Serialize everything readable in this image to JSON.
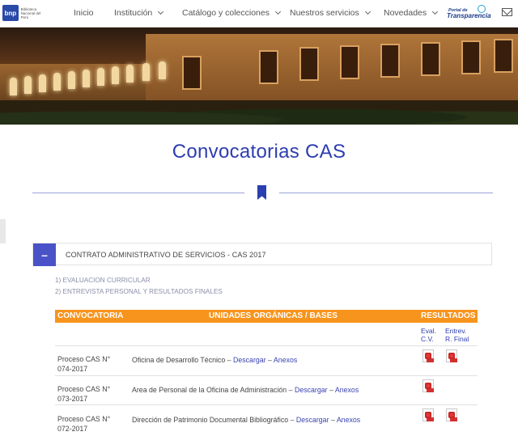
{
  "header": {
    "logo_mark": "bnp",
    "logo_text": "Biblioteca Nacional del Perú",
    "nav": [
      {
        "label": "Inicio",
        "dropdown": false
      },
      {
        "label": "Institución",
        "dropdown": true
      },
      {
        "label": "Catálogo y colecciones",
        "dropdown": true
      },
      {
        "label": "Nuestros servicios",
        "dropdown": true
      },
      {
        "label": "Novedades",
        "dropdown": true
      }
    ],
    "transparency_top": "Portal de",
    "transparency_main": "Transparencia",
    "mail_icon": "envelope-icon"
  },
  "page": {
    "title": "Convocatorias CAS"
  },
  "accordion": {
    "toggle_symbol": "–",
    "label": "CONTRATO ADMINISTRATIVO DE SERVICIOS - CAS 2017"
  },
  "links": [
    "1) EVALUACION CURRICULAR",
    "2) ENTREVISTA PERSONAL Y RESULTADOS FINALES"
  ],
  "table": {
    "headers": {
      "convocatoria": "CONVOCATORIA",
      "unidades": "UNIDADES ORGÁNICAS / BASES",
      "resultados": "RESULTADOS"
    },
    "subheaders": {
      "eval_line1": "Eval.",
      "eval_line2": "C.V.",
      "entrev_line1": "Entrev.",
      "entrev_line2": "R. Final"
    },
    "rows": [
      {
        "proceso_line1": "Proceso CAS N°",
        "proceso_line2": "074-2017",
        "unidad": "Oficina de Desarrollo Técnico – ",
        "descargar": "Descargar",
        "sep": " – ",
        "anexos": "Anexos",
        "eval_pdf": true,
        "entrev_pdf": true
      },
      {
        "proceso_line1": "Proceso CAS N°",
        "proceso_line2": "073-2017",
        "unidad": "Area de Personal de la Oficina de Administración – ",
        "descargar": "Descargar",
        "sep": " – ",
        "anexos": "Anexos",
        "eval_pdf": true,
        "entrev_pdf": false
      },
      {
        "proceso_line1": "Proceso CAS N°",
        "proceso_line2": "072-2017",
        "unidad": "Dirección de Patrimonio Documental Bibliográfico – ",
        "descargar": "Descargar",
        "sep": " – ",
        "anexos": "Anexos",
        "eval_pdf": true,
        "entrev_pdf": true
      }
    ]
  }
}
